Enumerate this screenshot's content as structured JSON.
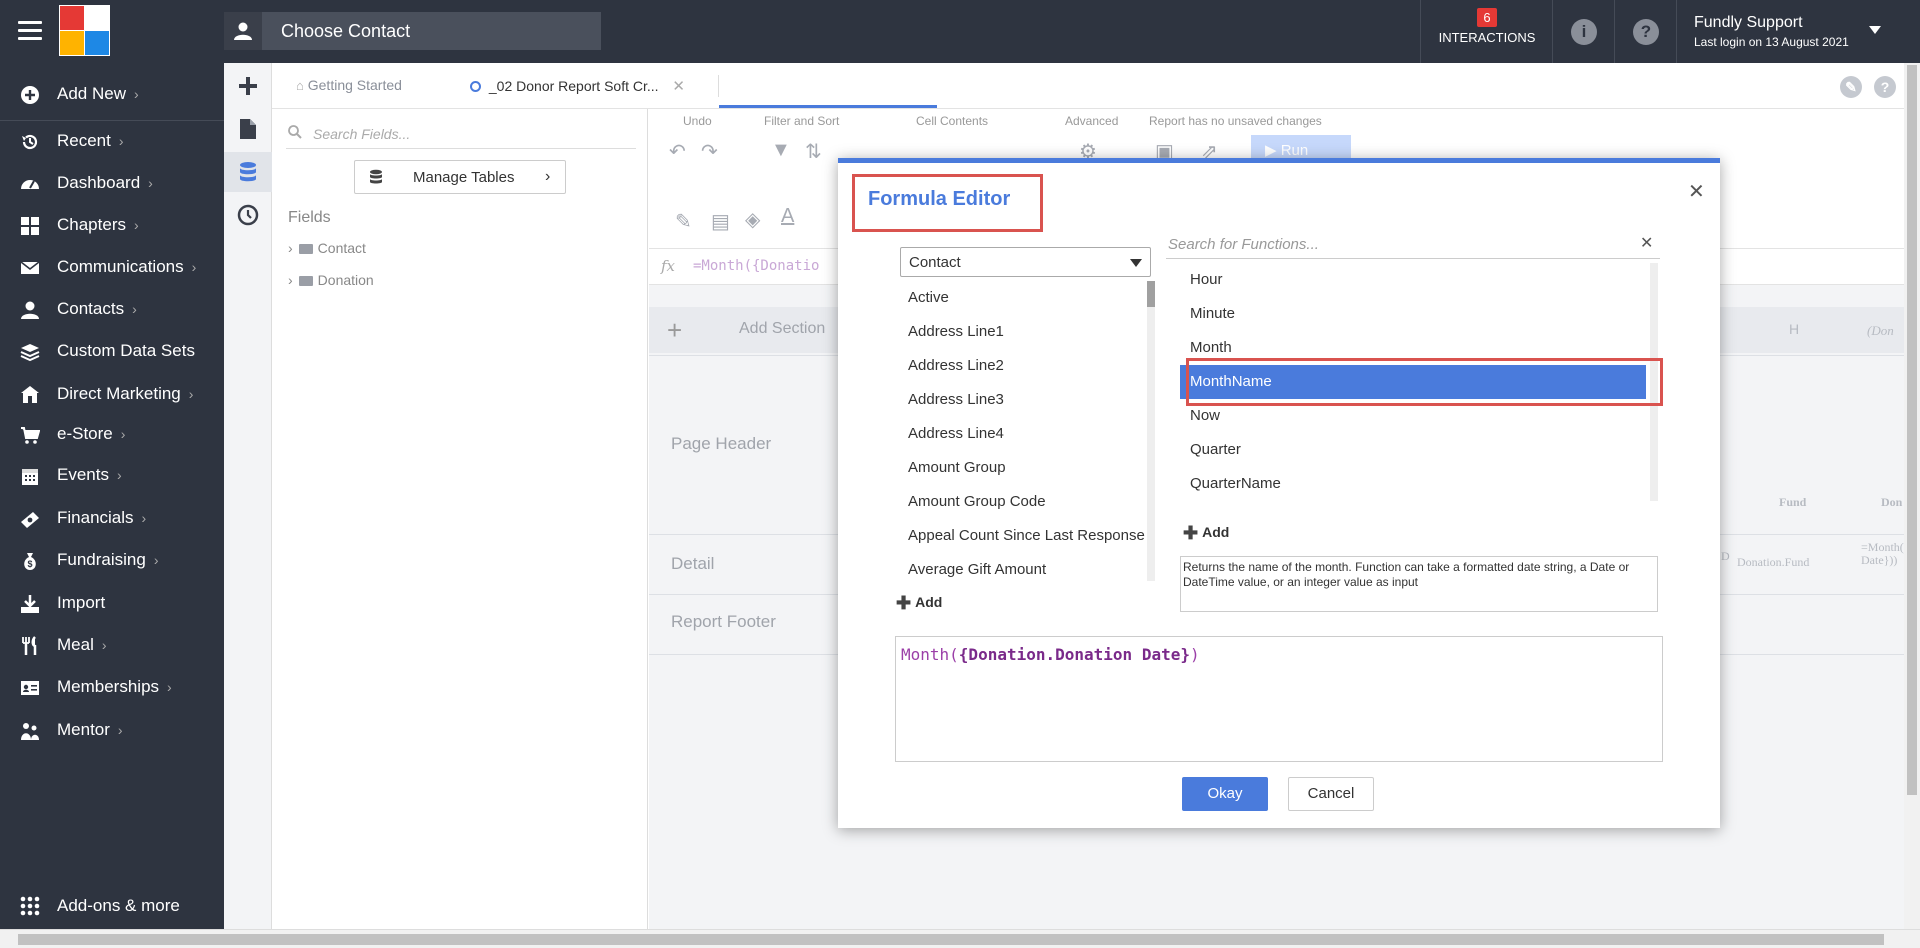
{
  "header": {
    "contact_label": "Choose Contact",
    "interactions_count": "6",
    "interactions_label": "INTERACTIONS",
    "user_name": "Fundly Support",
    "last_login": "Last login on 13 August 2021",
    "logo_colors": [
      "#e53935",
      "#ffffff",
      "#ffb300",
      "#1e88e5"
    ]
  },
  "sidebar": {
    "items": [
      {
        "label": "Add New",
        "icon": "plus-circle-icon"
      },
      {
        "label": "Recent",
        "icon": "history-icon"
      },
      {
        "label": "Dashboard",
        "icon": "dashboard-icon"
      },
      {
        "label": "Chapters",
        "icon": "grid-icon"
      },
      {
        "label": "Communications",
        "icon": "envelope-icon"
      },
      {
        "label": "Contacts",
        "icon": "user-icon"
      },
      {
        "label": "Custom Data Sets",
        "icon": "layers-icon"
      },
      {
        "label": "Direct Marketing",
        "icon": "building-icon"
      },
      {
        "label": "e-Store",
        "icon": "cart-icon"
      },
      {
        "label": "Events",
        "icon": "calendar-icon"
      },
      {
        "label": "Financials",
        "icon": "money-icon"
      },
      {
        "label": "Fundraising",
        "icon": "moneybag-icon"
      },
      {
        "label": "Import",
        "icon": "import-icon"
      },
      {
        "label": "Meal",
        "icon": "utensils-icon"
      },
      {
        "label": "Memberships",
        "icon": "id-card-icon"
      },
      {
        "label": "Mentor",
        "icon": "mentor-icon"
      }
    ],
    "bottom_label": "Add-ons & more"
  },
  "tabs": [
    {
      "label": "Getting Started"
    },
    {
      "label": "_02 Donor Report Soft Cr..."
    }
  ],
  "field_panel": {
    "search_placeholder": "Search Fields...",
    "manage_tables": "Manage Tables",
    "fields_title": "Fields",
    "tree": [
      "Contact",
      "Donation"
    ]
  },
  "ribbon": {
    "groups": [
      "Undo",
      "Filter and Sort",
      "Cell Contents",
      "Advanced",
      "Report has no unsaved changes"
    ],
    "run_label": "Run"
  },
  "designer": {
    "formula": "=Month({Donatio",
    "add_section": "Add Section",
    "bands": [
      "Page Header",
      "Detail",
      "Report Footer"
    ],
    "ghost_cells": {
      "col_h": "H",
      "col_last": "(Don",
      "fund_header": "Fund",
      "don_header": "Don",
      "fund_cell": "Donation.Fund",
      "month_cell": "=Month({Donation Date}))",
      "d_cell": "D"
    }
  },
  "modal": {
    "title": "Formula Editor",
    "table_select": "Contact",
    "fields": [
      "Active",
      "Address Line1",
      "Address Line2",
      "Address Line3",
      "Address Line4",
      "Amount Group",
      "Amount Group Code",
      "Appeal Count Since Last Response",
      "Average Gift Amount"
    ],
    "fields_add": "Add",
    "function_search_placeholder": "Search for Functions...",
    "functions": [
      "Hour",
      "Minute",
      "Month",
      "MonthName",
      "Now",
      "Quarter",
      "QuarterName"
    ],
    "selected_function": "MonthName",
    "functions_add": "Add",
    "description": "Returns the name of the month. Function can take a formatted date string, a Date or DateTime value, or an integer value as input",
    "formula_fn": "Month(",
    "formula_field": "{Donation.Donation Date}",
    "formula_close": ")",
    "okay": "Okay",
    "cancel": "Cancel"
  },
  "colors": {
    "accent": "#4a7bdc",
    "nav_bg": "#2e3440",
    "highlight_border": "#d9534f",
    "badge": "#e53935"
  }
}
